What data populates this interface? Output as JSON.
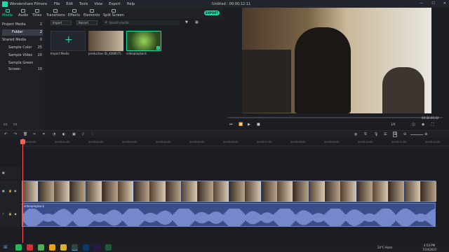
{
  "app": {
    "name": "Wondershare Filmora",
    "menu": [
      "File",
      "Edit",
      "Tools",
      "View",
      "Export",
      "Help"
    ],
    "title": "Untitled : 00:00:12:11",
    "export_label": "EXPORT"
  },
  "tabs": [
    {
      "label": "Media"
    },
    {
      "label": "Audio"
    },
    {
      "label": "Titles"
    },
    {
      "label": "Transitions"
    },
    {
      "label": "Effects"
    },
    {
      "label": "Elements"
    },
    {
      "label": "Split Screen"
    }
  ],
  "sidebar": {
    "items": [
      {
        "label": "Project Media",
        "count": "2"
      },
      {
        "label": "Folder",
        "count": "2"
      },
      {
        "label": "Shared Media",
        "count": "0"
      },
      {
        "label": "Sample Color",
        "count": "25"
      },
      {
        "label": "Sample Video",
        "count": "20"
      },
      {
        "label": "Sample Green Screen",
        "count": "10"
      }
    ]
  },
  "media": {
    "import_dd": "Import",
    "record_dd": "Record",
    "search_placeholder": "Search media",
    "items": [
      {
        "label": "Import Media"
      },
      {
        "label": "production ID_4088575"
      },
      {
        "label": "videoplayback"
      }
    ]
  },
  "preview": {
    "time": "00:00:00:02",
    "zoom": "1/4"
  },
  "timeline": {
    "ticks": [
      "00:00:00:00",
      "00:00:01:00",
      "00:00:02:00",
      "00:00:03:00",
      "00:00:04:00",
      "00:00:05:00",
      "00:00:06:00",
      "00:00:07:00",
      "00:00:08:00",
      "00:00:09:00",
      "00:00:10:00",
      "00:00:11:00",
      "00:00:12:00"
    ],
    "audio_clip_label": "videoplayback"
  },
  "taskbar": {
    "weather": "24°C Haze",
    "time": "4:54 PM",
    "date": "7/24/2022"
  },
  "colors": {
    "accent": "#1fd8a4",
    "clip": "#3a4c8a",
    "playhead": "#ff5a5a"
  }
}
